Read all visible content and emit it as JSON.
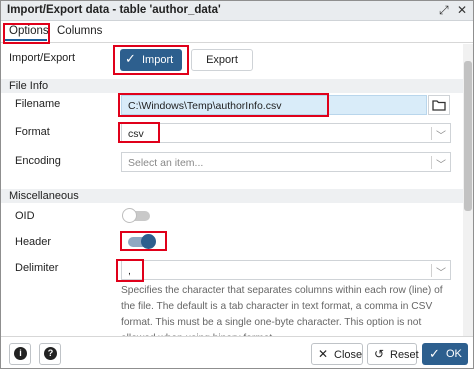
{
  "window": {
    "title": "Import/Export data - table 'author_data'",
    "icons": [
      "expand-icon",
      "close-icon"
    ]
  },
  "tabs": [
    {
      "label": "Options",
      "active": true
    },
    {
      "label": "Columns",
      "active": false
    }
  ],
  "import_export": {
    "label": "Import/Export",
    "import_label": "Import",
    "export_label": "Export",
    "selected": "Import"
  },
  "file_info": {
    "section": "File Info",
    "filename_label": "Filename",
    "filename_value": "C:\\Windows\\Temp\\authorInfo.csv",
    "format_label": "Format",
    "format_value": "csv",
    "encoding_label": "Encoding",
    "encoding_placeholder": "Select an item..."
  },
  "misc": {
    "section": "Miscellaneous",
    "oid_label": "OID",
    "oid_on": false,
    "header_label": "Header",
    "header_on": true,
    "delimiter_label": "Delimiter",
    "delimiter_value": ",",
    "help_text": "Specifies the character that separates columns within each row (line) of the file. The default is a tab character in text format, a comma in CSV format. This must be a single one-byte character. This option is not allowed when using binary format."
  },
  "footer": {
    "info_icon": "info-icon",
    "help_icon": "help-icon",
    "close_label": "Close",
    "reset_label": "Reset",
    "ok_label": "OK"
  },
  "colors": {
    "accent": "#2d5f8e",
    "highlight": "#e0001a",
    "filename_bg": "#d9ecf9",
    "toggle_on": "#2d5f8e",
    "toggle_off": "#c9c9c9"
  }
}
